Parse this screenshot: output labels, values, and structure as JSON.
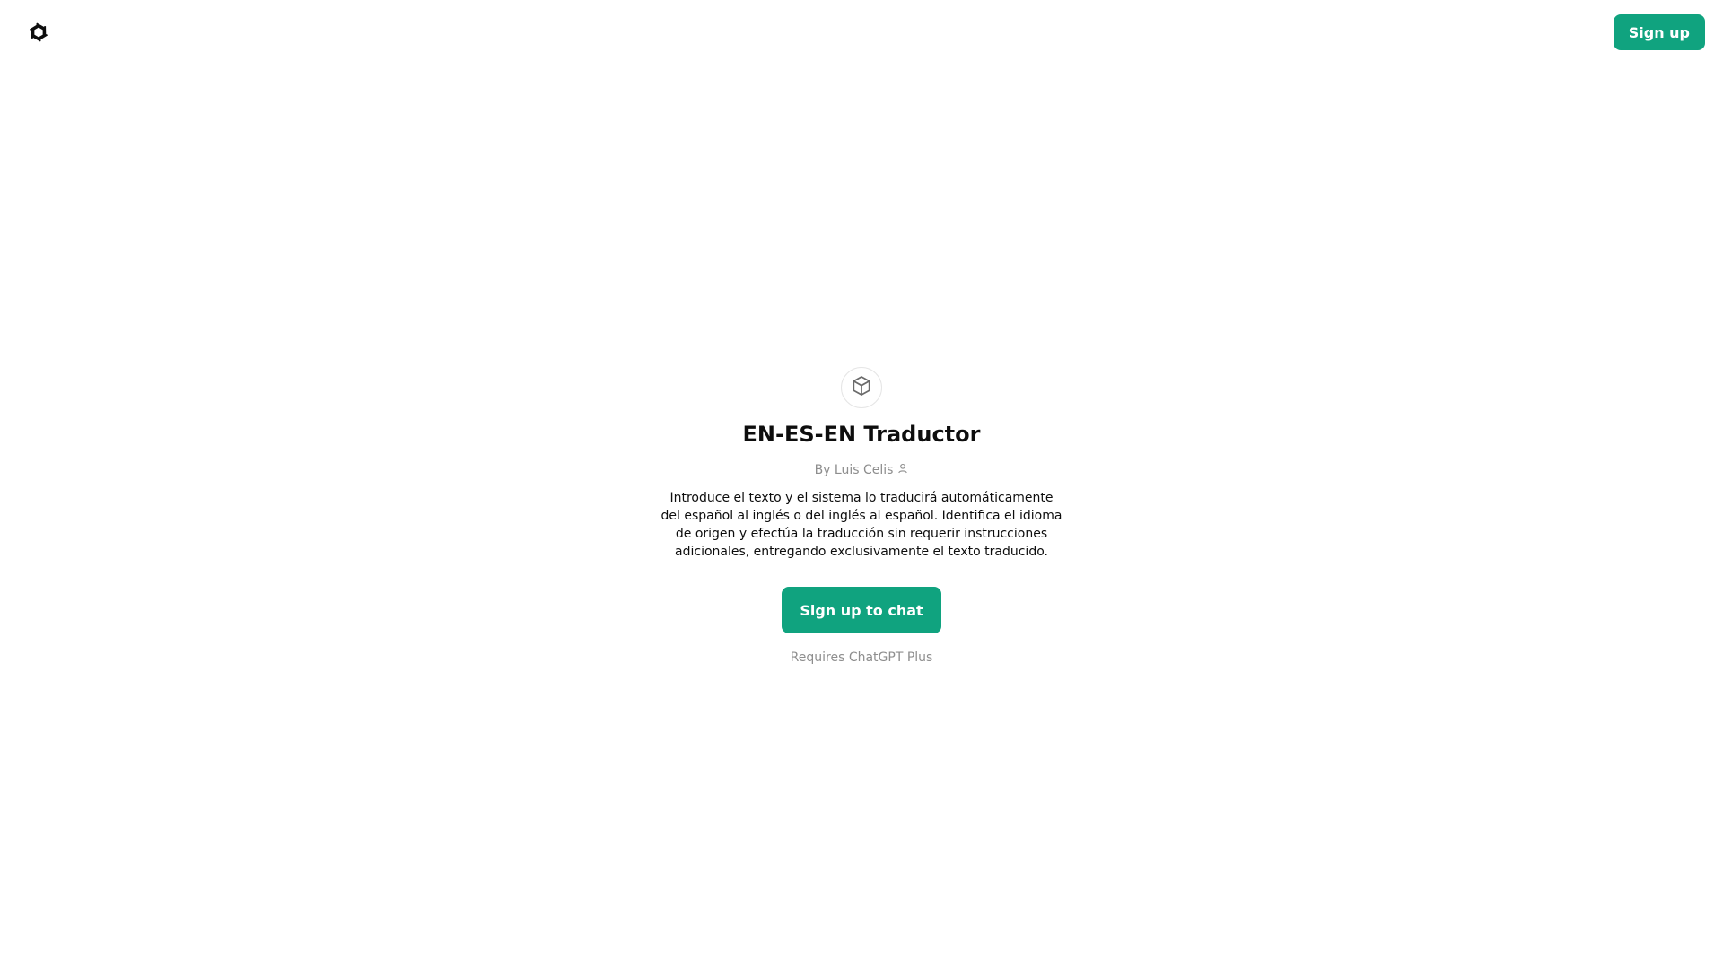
{
  "header": {
    "logo_icon": "openai-logo-icon",
    "signup_label": "Sign up"
  },
  "gpt": {
    "avatar_icon": "cube-icon",
    "title": "EN-ES-EN Traductor",
    "author": "By Luis Celis",
    "author_icon": "person-icon",
    "description": "Introduce el texto y el sistema lo traducirá automáticamente del español al inglés o del inglés al español. Identifica el idioma de origen y efectúa la traducción sin requerir instrucciones adicionales, entregando exclusivamente el texto traducido.",
    "cta_label": "Sign up to chat",
    "requirement": "Requires ChatGPT Plus"
  },
  "colors": {
    "accent": "#10a37f",
    "muted_text": "#8e8e8e",
    "primary_text": "#0d0d0d"
  }
}
